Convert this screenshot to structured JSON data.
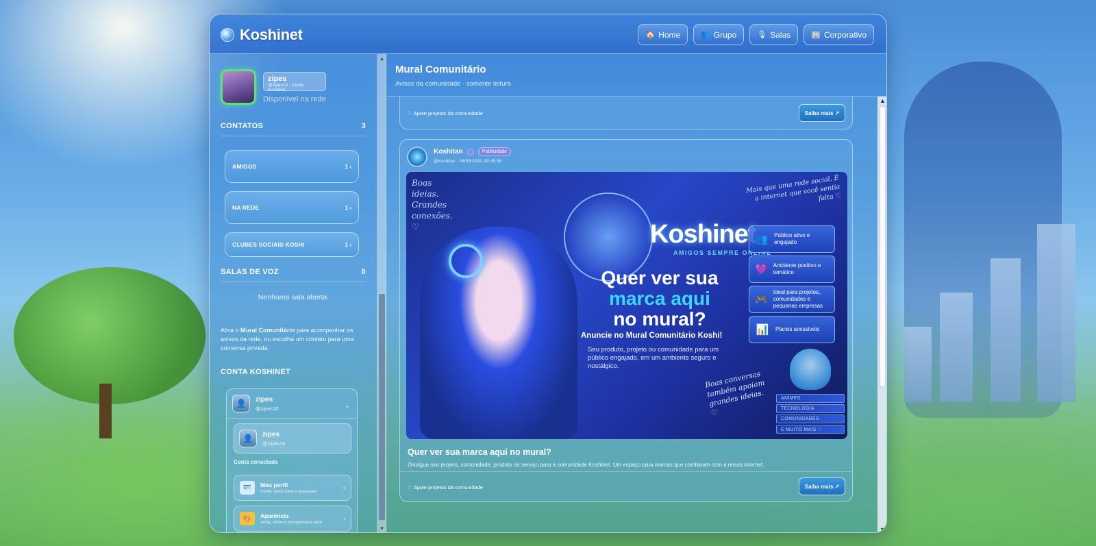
{
  "app": {
    "title": "Koshinet"
  },
  "nav": [
    {
      "label": "Home",
      "icon": "🏠"
    },
    {
      "label": "Grupo",
      "icon": "👥"
    },
    {
      "label": "Salas",
      "icon": "🎙"
    },
    {
      "label": "Corporativo",
      "icon": "🏢"
    }
  ],
  "profile": {
    "name": "zipes",
    "handle": "@zipes10 · Conta Koshinet",
    "status": "Disponível na rede"
  },
  "contacts": {
    "title": "CONTATOS",
    "count": "3",
    "items": [
      {
        "label": "AMIGOS",
        "count": "1 ›"
      },
      {
        "label": "NA REDE",
        "count": "1 ›"
      },
      {
        "label": "CLUBES SOCIAIS KOSHI",
        "count": "1 ›"
      }
    ]
  },
  "voice_rooms": {
    "title": "SALAS DE VOZ",
    "count": "0",
    "empty": "Nenhuma sala aberta."
  },
  "help": {
    "prefix": "Abra o ",
    "bold": "Mural Comunitário",
    "suffix": " para acompanhar os avisos da rede, ou escolha um contato para uma conversa privada."
  },
  "account": {
    "title": "CONTA KOSHINET",
    "name": "zipes",
    "handle": "@zipes10",
    "sub_name": "zipes",
    "sub_handle": "@zipes10",
    "connected": "Conta conectada",
    "menu": [
      {
        "title": "Meu perfil",
        "desc": "Nome, fundo Aero e avaliações",
        "icon": "🪪"
      },
      {
        "title": "Aparência",
        "desc": "Tema, fundo e transparência Aero",
        "icon": "🎨"
      }
    ]
  },
  "main": {
    "title": "Mural Comunitário",
    "subtitle": "Avisos da comunidade · somente leitura"
  },
  "post_prev": {
    "support": "Apoie projetos da comunidade",
    "button": "Saiba mais ↗"
  },
  "post": {
    "author": "Koshitan",
    "badge": "Publicidade",
    "meta": "@Koshitan · 04/09/2026, 00:45:38",
    "title": "Quer ver sua marca aqui no mural?",
    "text": "Divulgue seu projeto, comunidade, produto ou serviço para a comunidade Koshinet. Um espaço para marcas que combinam com a nossa internet.",
    "support": "Apoie projetos da comunidade",
    "button": "Saiba mais ↗"
  },
  "banner": {
    "hand_left": "Boas ideias. Grandes conexões. ♡",
    "hand_right": "Mais que uma rede social. É a internet que você sentia falta ♡",
    "logo": "Koshinet",
    "tagline": "AMIGOS SEMPRE ONLINE",
    "headline_1": "Quer ver sua",
    "headline_2": "marca aqui",
    "headline_3": "no mural?",
    "cta": "Anuncie no Mural Comunitário Koshi!",
    "desc": "Seu produto, projeto ou comunidade para um público engajado, em um ambiente seguro e nostálgico.",
    "hand_bottom": "Boas conversas também apoiam grandes ideias. ♡",
    "features": [
      {
        "text": "Público ativo e engajado",
        "icon": "👥"
      },
      {
        "text": "Ambiente positivo e temático",
        "icon": "💜"
      },
      {
        "text": "Ideal para projetos, comunidades e pequenas empresas",
        "icon": "🎮"
      },
      {
        "text": "Planos acessíveis",
        "icon": "📊"
      }
    ],
    "books": [
      "ANIMES",
      "TECNOLOGIA",
      "COMUNIDADES",
      "E MUITO MAIS ♡"
    ]
  }
}
